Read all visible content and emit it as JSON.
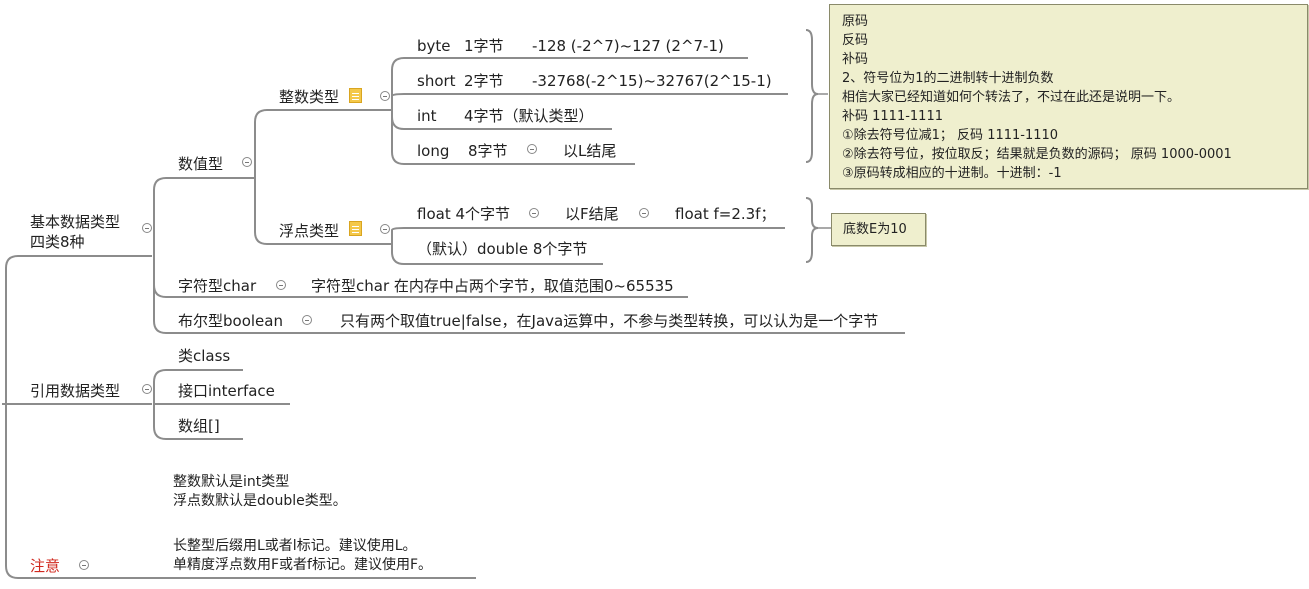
{
  "root": {
    "basic": {
      "label_line1": "基本数据类型",
      "label_line2": "四类8种",
      "numeric": {
        "label": "数值型",
        "integer": {
          "label": "整数类型",
          "byte": {
            "name": "byte",
            "size": "1字节",
            "range": "-128 (-2^7)~127 (2^7-1)"
          },
          "short": {
            "name": "short",
            "size": "2字节",
            "range": "-32768(-2^15)~32767(2^15-1)"
          },
          "int": {
            "name": "int",
            "size": "4字节（默认类型）"
          },
          "long": {
            "name": "long",
            "size": "8字节",
            "suffix": "以L结尾"
          }
        },
        "float_types": {
          "label": "浮点类型",
          "float": {
            "name": "float 4个字节",
            "suffix": "以F结尾",
            "example": "float f=2.3f；"
          },
          "double": {
            "name": "（默认）double 8个字节"
          }
        }
      },
      "char": {
        "label": "字符型char",
        "desc": "字符型char 在内存中占两个字节，取值范围0~65535"
      },
      "boolean": {
        "label": "布尔型boolean",
        "desc": "只有两个取值true|false，在Java运算中，不参与类型转换，可以认为是一个字节"
      }
    },
    "reference": {
      "label": "引用数据类型",
      "items": [
        "类class",
        "接口interface",
        "数组[]"
      ]
    },
    "notice": {
      "label": "注意",
      "lines": [
        "整数默认是int类型",
        "浮点数默认是double类型。",
        "",
        "长整型后缀用L或者l标记。建议使用L。",
        "单精度浮点数用F或者f标记。建议使用F。"
      ]
    }
  },
  "summary_integer": {
    "lines": [
      "原码",
      "反码",
      "补码",
      "2、符号位为1的二进制转十进制负数",
      "相信大家已经知道如何个转法了，不过在此还是说明一下。",
      "补码 1111-1111",
      "①除去符号位减1；             反码 1111-1110",
      "②除去符号位，按位取反；结果就是负数的源码；        原码 1000-0001",
      "③原码转成相应的十进制。十进制：-1"
    ]
  },
  "summary_float": {
    "text": "底数E为10"
  },
  "colors": {
    "line": "#8c8c8c",
    "note_bg": "#efefce",
    "notice_label": "#d0281e",
    "memo": "#f4c84a"
  }
}
